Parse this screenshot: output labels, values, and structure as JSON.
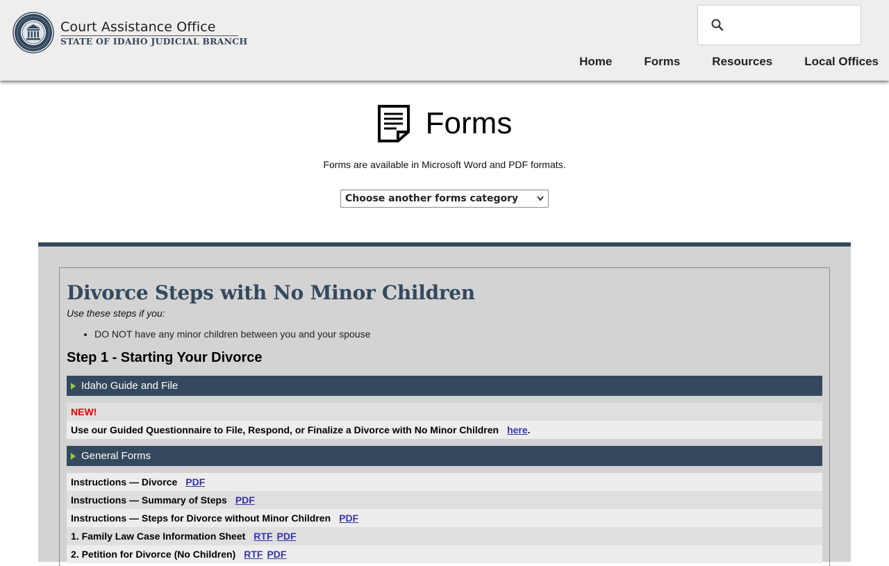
{
  "header": {
    "brand_title": "Court Assistance Office",
    "brand_subtitle": "STATE OF IDAHO JUDICIAL BRANCH",
    "search_placeholder": "",
    "nav": [
      "Home",
      "Forms",
      "Resources",
      "Local Offices"
    ]
  },
  "page": {
    "title": "Forms",
    "intro": "Forms are available in Microsoft Word and PDF formats.",
    "category_select": "Choose another forms category"
  },
  "content": {
    "heading": "Divorce Steps with No Minor Children",
    "use_steps": "Use these steps if you:",
    "bullets": [
      "DO NOT have any minor children between you and your spouse"
    ],
    "step1_heading": "Step 1 - Starting Your Divorce",
    "section1": {
      "title": "Idaho Guide and File",
      "new_label": "NEW!",
      "guided_text": "Use our Guided Questionnaire to File, Respond, or Finalize a Divorce with No Minor Children",
      "guided_link": "here",
      "guided_tail": "."
    },
    "section2": {
      "title": "General Forms",
      "rows": [
        {
          "label": "Instructions — Divorce",
          "links": [
            "PDF"
          ]
        },
        {
          "label": "Instructions — Summary of Steps",
          "links": [
            "PDF"
          ]
        },
        {
          "label": "Instructions — Steps for Divorce without Minor Children",
          "links": [
            "PDF"
          ]
        },
        {
          "label": "1. Family Law Case Information Sheet",
          "links": [
            "RTF",
            "PDF"
          ]
        },
        {
          "label": "2. Petition for Divorce (No Children)",
          "links": [
            "RTF",
            "PDF"
          ]
        }
      ]
    }
  },
  "colors": {
    "accent": "#34495e",
    "header_bg": "#eeeeee",
    "panel_bg": "#d3d3d3",
    "link": "#3434a8",
    "new": "#e00000",
    "arrow": "#9dcb3b"
  }
}
